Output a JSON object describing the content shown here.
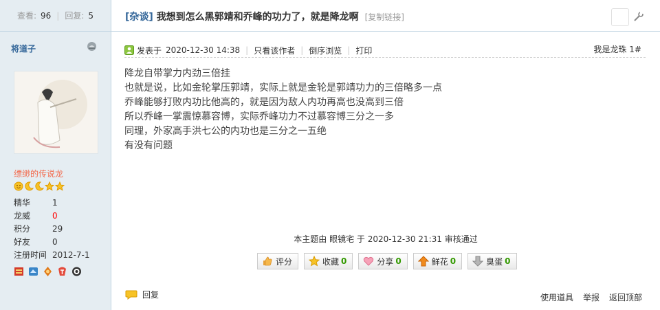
{
  "sidebar": {
    "views_label": "查看:",
    "views": "96",
    "replies_label": "回复:",
    "replies": "5",
    "author": "将道子",
    "rank": "缥缈的传说龙",
    "profile": [
      {
        "k": "精华",
        "v": "1"
      },
      {
        "k": "龙威",
        "v": "0"
      },
      {
        "k": "积分",
        "v": "29"
      },
      {
        "k": "好友",
        "v": "0"
      },
      {
        "k": "注册时间",
        "v": "2012-7-1"
      }
    ]
  },
  "thread": {
    "category": "杂谈",
    "title": "我想到怎么黑郭靖和乔峰的功力了，就是降龙啊",
    "copy_link": "[复制链接]"
  },
  "post": {
    "posted_prefix": "发表于",
    "posted_time": "2020-12-30 14:38",
    "only_author": "只看该作者",
    "reverse": "倒序浏览",
    "print": "打印",
    "floor_name": "我是龙珠",
    "floor_num": "1#",
    "lines": [
      "降龙自带掌力内劲三倍挂",
      "也就是说，比如金轮掌压郭靖，实际上就是金轮是郭靖功力的三倍略多一点",
      "",
      "乔峰能够打败内功比他高的，就是因为敌人内功再高也没高到三倍",
      "",
      "所以乔峰一掌震惊慕容博，实际乔峰功力不过慕容博三分之一多",
      "",
      "同理，外家高手洪七公的内功也是三分之一五绝",
      "",
      "有没有问题"
    ],
    "review_note": "本主题由 眼镜宅 于 2020-12-30 21:31 审核通过"
  },
  "actions": [
    {
      "label": "评分",
      "count": ""
    },
    {
      "label": "收藏",
      "count": "0"
    },
    {
      "label": "分享",
      "count": "0"
    },
    {
      "label": "鲜花",
      "count": "0"
    },
    {
      "label": "臭蛋",
      "count": "0"
    }
  ],
  "footer": {
    "reply": "回复",
    "use_tool": "使用道具",
    "report": "举报",
    "back_top": "返回顶部"
  },
  "colors": {
    "sidebar_bg": "#e5edf2",
    "link_blue": "#336699",
    "rank_orange": "#f26c4f",
    "count_green": "#339900"
  }
}
